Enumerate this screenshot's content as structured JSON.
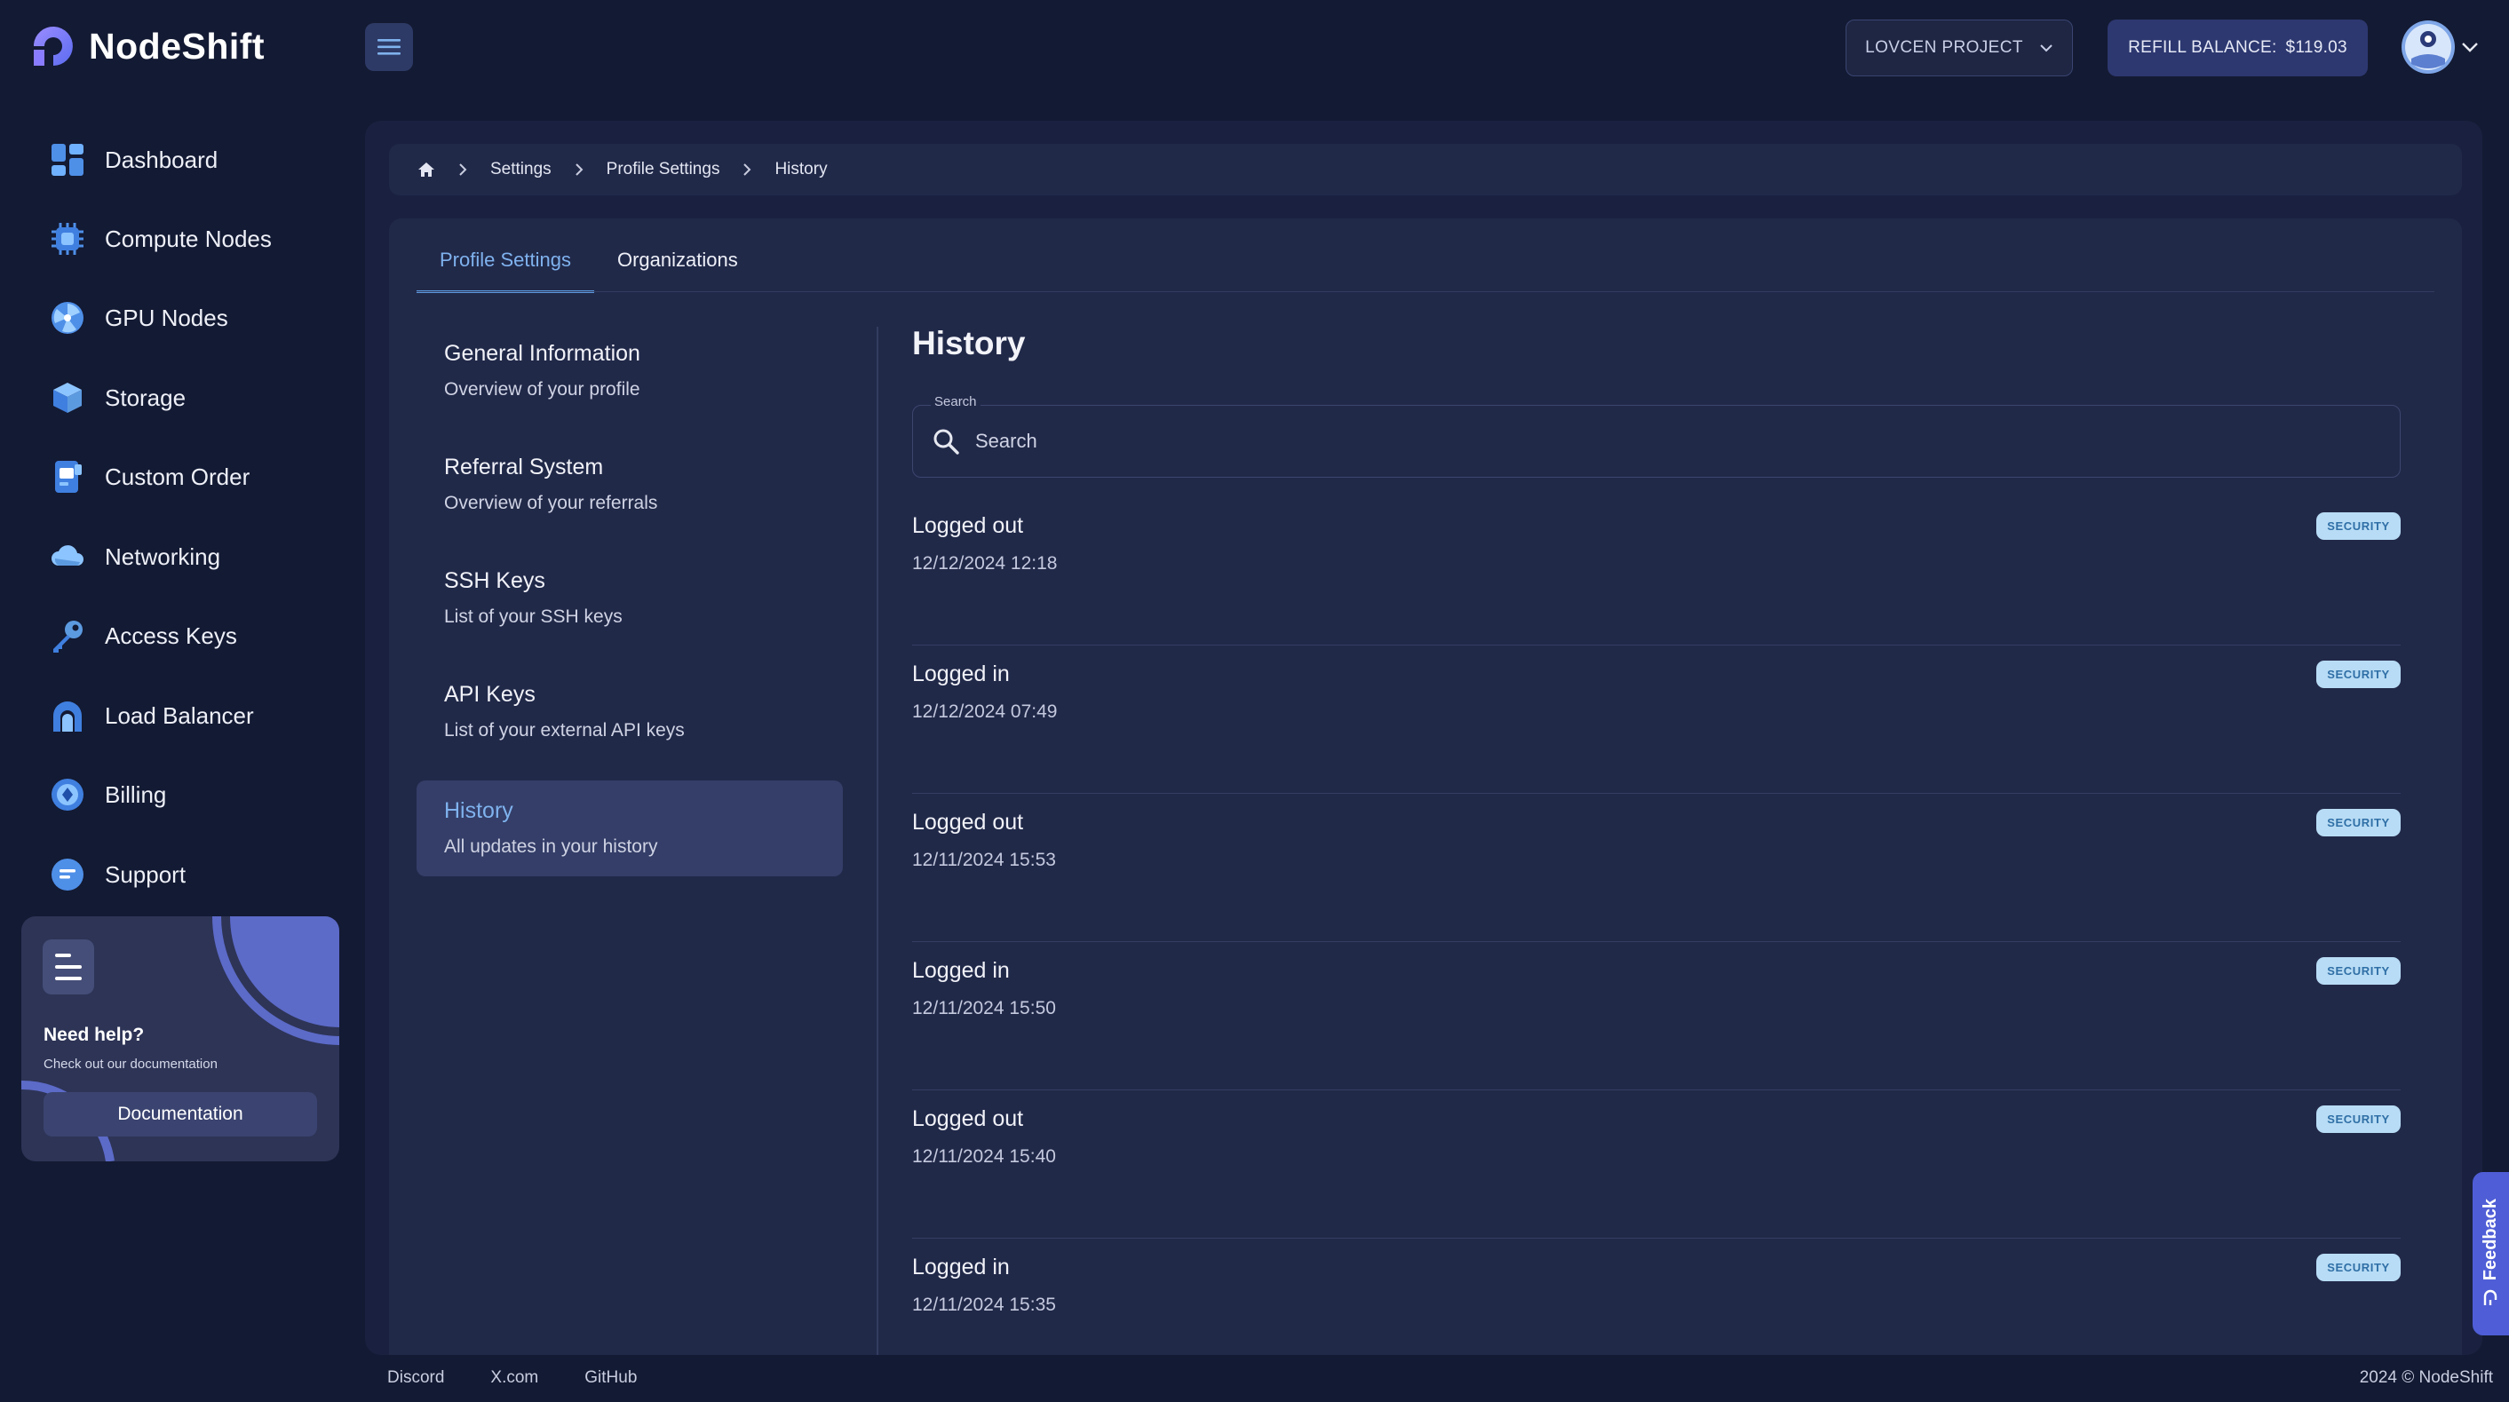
{
  "app": {
    "name": "NodeShift"
  },
  "header": {
    "project_label": "LOVCEN PROJECT",
    "refill_label": "REFILL BALANCE:",
    "balance": "$119.03"
  },
  "sidebar": {
    "items": [
      {
        "label": "Dashboard",
        "icon": "dashboard-icon"
      },
      {
        "label": "Compute Nodes",
        "icon": "cpu-icon"
      },
      {
        "label": "GPU Nodes",
        "icon": "gpu-icon"
      },
      {
        "label": "Storage",
        "icon": "storage-cube-icon"
      },
      {
        "label": "Custom Order",
        "icon": "custom-order-icon"
      },
      {
        "label": "Networking",
        "icon": "cloud-icon"
      },
      {
        "label": "Access Keys",
        "icon": "key-icon"
      },
      {
        "label": "Load Balancer",
        "icon": "load-balancer-icon"
      },
      {
        "label": "Billing",
        "icon": "billing-icon"
      },
      {
        "label": "Support",
        "icon": "chat-icon"
      }
    ],
    "help": {
      "title": "Need help?",
      "subtitle": "Check out our documentation",
      "button": "Documentation"
    }
  },
  "breadcrumb": {
    "items": [
      "Settings",
      "Profile Settings",
      "History"
    ]
  },
  "tabs": [
    {
      "label": "Profile Settings",
      "active": true
    },
    {
      "label": "Organizations",
      "active": false
    }
  ],
  "side_menu": [
    {
      "title": "General Information",
      "subtitle": "Overview of your profile",
      "active": false
    },
    {
      "title": "Referral System",
      "subtitle": "Overview of your referrals",
      "active": false
    },
    {
      "title": "SSH Keys",
      "subtitle": "List of your SSH keys",
      "active": false
    },
    {
      "title": "API Keys",
      "subtitle": "List of your external API keys",
      "active": false
    },
    {
      "title": "History",
      "subtitle": "All updates in your history",
      "active": true
    }
  ],
  "history": {
    "title": "History",
    "search_label": "Search",
    "search_placeholder": "Search",
    "entries": [
      {
        "title": "Logged out",
        "time": "12/12/2024 12:18",
        "badge": "SECURITY"
      },
      {
        "title": "Logged in",
        "time": "12/12/2024 07:49",
        "badge": "SECURITY"
      },
      {
        "title": "Logged out",
        "time": "12/11/2024 15:53",
        "badge": "SECURITY"
      },
      {
        "title": "Logged in",
        "time": "12/11/2024 15:50",
        "badge": "SECURITY"
      },
      {
        "title": "Logged out",
        "time": "12/11/2024 15:40",
        "badge": "SECURITY"
      },
      {
        "title": "Logged in",
        "time": "12/11/2024 15:35",
        "badge": "SECURITY"
      }
    ]
  },
  "footer": {
    "links": [
      "Discord",
      "X.com",
      "GitHub"
    ],
    "copyright": "2024 © NodeShift"
  },
  "feedback": {
    "label": "Feedback"
  },
  "colors": {
    "background": "#131a33",
    "panel": "#212949",
    "accent": "#7fb2ee",
    "badge": "#b8dcf5"
  }
}
